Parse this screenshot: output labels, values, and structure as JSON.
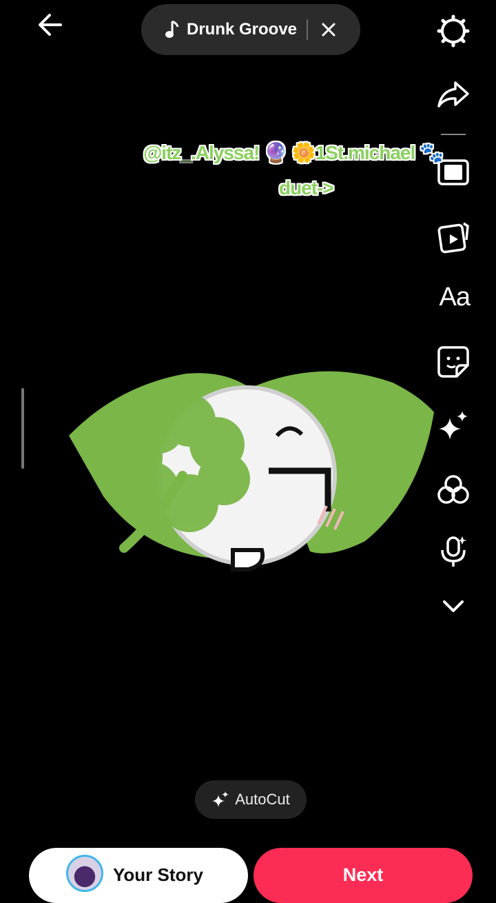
{
  "top_bar": {
    "sound_name": "Drunk Groove",
    "back_icon": "arrow-left-icon",
    "close_icon": "close-icon"
  },
  "right_rail": {
    "items": [
      {
        "icon": "settings-icon"
      },
      {
        "icon": "share-arrow-icon"
      },
      {
        "icon": "flip-phone-icon"
      },
      {
        "icon": "templates-icon"
      },
      {
        "icon": "text-icon",
        "label": "Aa"
      },
      {
        "icon": "sticker-icon"
      },
      {
        "icon": "effects-sparkle-icon"
      },
      {
        "icon": "filters-icon"
      },
      {
        "icon": "voice-effect-icon"
      },
      {
        "icon": "chevron-down-icon"
      }
    ]
  },
  "overlay": {
    "line1": "@itz_.Alyssa! 🔮 🌼1St.michael 🐾",
    "line2": "duet->"
  },
  "autocut": {
    "label": "AutoCut"
  },
  "bottom": {
    "your_story_label": "Your Story",
    "next_label": "Next"
  },
  "colors": {
    "accent": "#fd2c55",
    "overlay_text": "#8ad15f",
    "leaf": "#7ab648"
  }
}
